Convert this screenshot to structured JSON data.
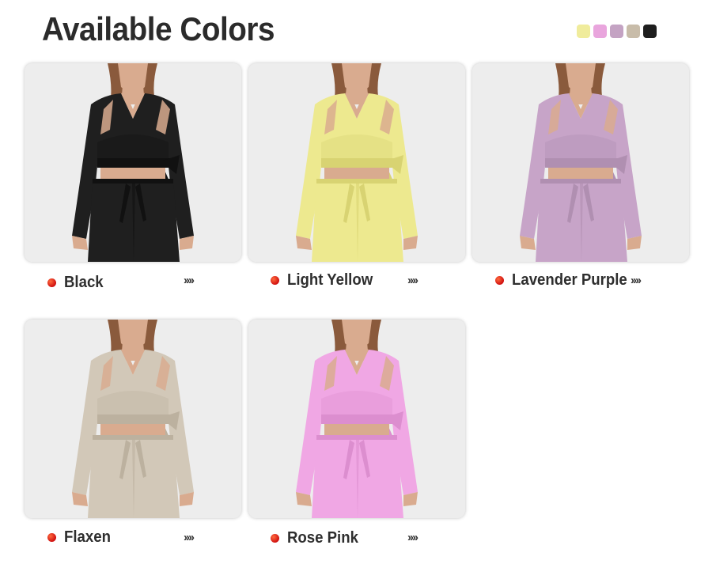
{
  "title": "Available Colors",
  "swatches": [
    {
      "name": "Light Yellow",
      "color": "#f0ec9c"
    },
    {
      "name": "Rose Pink",
      "color": "#e9a5dd"
    },
    {
      "name": "Lavender Purple",
      "color": "#c4a3c3"
    },
    {
      "name": "Flaxen",
      "color": "#c8bca9"
    },
    {
      "name": "Black",
      "color": "#1e1e1e"
    }
  ],
  "colors": [
    {
      "label": "Black",
      "garment": "#1f1f1f",
      "shade": "#111111",
      "more": "››››"
    },
    {
      "label": "Light Yellow",
      "garment": "#ede98f",
      "shade": "#d8d372",
      "more": "››››"
    },
    {
      "label": "Lavender Purple",
      "garment": "#c7a4c8",
      "shade": "#b08fb1",
      "more": "››››"
    },
    {
      "label": "Flaxen",
      "garment": "#d2c8b8",
      "shade": "#bcb19f",
      "more": "››››"
    },
    {
      "label": "Rose Pink",
      "garment": "#f0a7e4",
      "shade": "#dc8ecf",
      "more": "››››"
    }
  ]
}
